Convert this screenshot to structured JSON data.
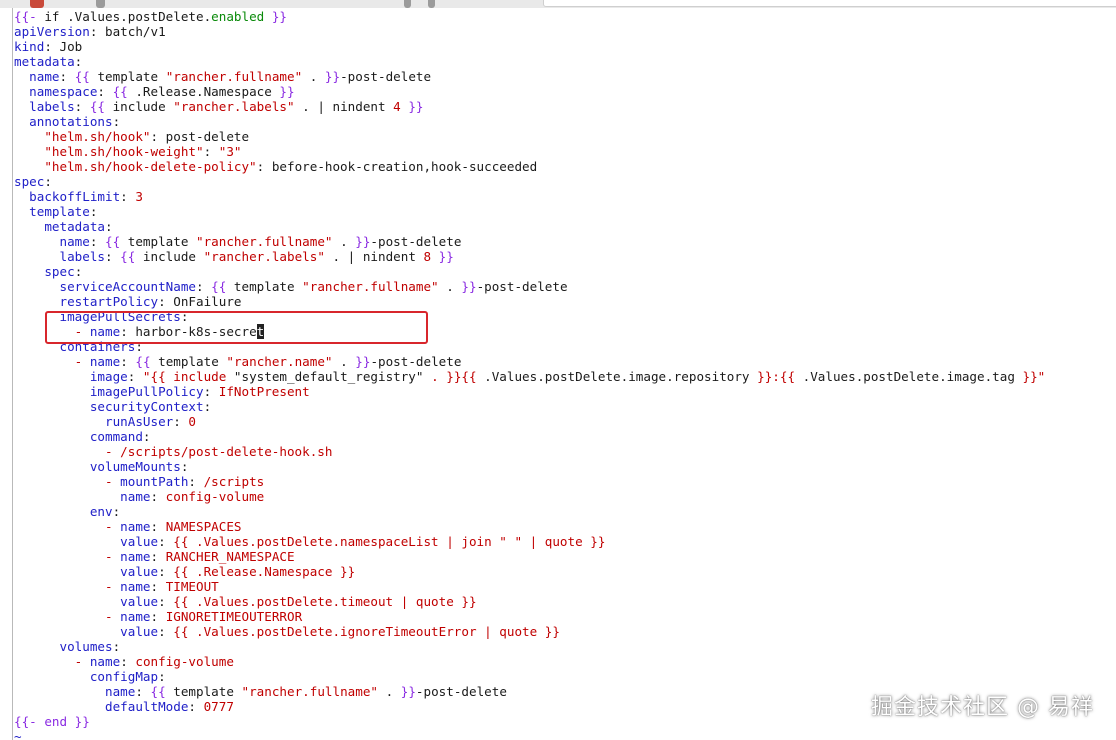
{
  "colors": {
    "template_delim": "#8a2be2",
    "yaml_key": "#2020c8",
    "string_value": "#c00000",
    "text": "#1a1a1a",
    "highlight_box": "#d8262c"
  },
  "editor": {
    "lines": [
      [
        [
          "kw",
          "{{- "
        ],
        [
          "plain",
          "if .Values.postDelete."
        ],
        [
          "green",
          "enabled"
        ],
        [
          "kw",
          " }}"
        ]
      ],
      [
        [
          "k1",
          "apiVersion"
        ],
        [
          "plain",
          ": batch/v1"
        ]
      ],
      [
        [
          "k1",
          "kind"
        ],
        [
          "plain",
          ": Job"
        ]
      ],
      [
        [
          "k1",
          "metadata"
        ],
        [
          "plain",
          ":"
        ]
      ],
      [
        [
          "plain",
          "  "
        ],
        [
          "k1",
          "name"
        ],
        [
          "plain",
          ": "
        ],
        [
          "kw",
          "{{"
        ],
        [
          "plain",
          " template "
        ],
        [
          "str",
          "\"rancher.fullname\""
        ],
        [
          "plain",
          " . "
        ],
        [
          "kw",
          "}}"
        ],
        [
          "plain",
          "-post-delete"
        ]
      ],
      [
        [
          "plain",
          "  "
        ],
        [
          "k1",
          "namespace"
        ],
        [
          "plain",
          ": "
        ],
        [
          "kw",
          "{{"
        ],
        [
          "plain",
          " .Release.Namespace "
        ],
        [
          "kw",
          "}}"
        ]
      ],
      [
        [
          "plain",
          "  "
        ],
        [
          "k1",
          "labels"
        ],
        [
          "plain",
          ": "
        ],
        [
          "kw",
          "{{"
        ],
        [
          "plain",
          " include "
        ],
        [
          "str",
          "\"rancher.labels\""
        ],
        [
          "plain",
          " . | nindent "
        ],
        [
          "num",
          "4"
        ],
        [
          "kw",
          " }}"
        ]
      ],
      [
        [
          "plain",
          "  "
        ],
        [
          "k1",
          "annotations"
        ],
        [
          "plain",
          ":"
        ]
      ],
      [
        [
          "plain",
          "    "
        ],
        [
          "str",
          "\"helm.sh/hook\""
        ],
        [
          "plain",
          ": post-delete"
        ]
      ],
      [
        [
          "plain",
          "    "
        ],
        [
          "str",
          "\"helm.sh/hook-weight\""
        ],
        [
          "plain",
          ": "
        ],
        [
          "str",
          "\"3\""
        ]
      ],
      [
        [
          "plain",
          "    "
        ],
        [
          "str",
          "\"helm.sh/hook-delete-policy\""
        ],
        [
          "plain",
          ": before-hook-creation,hook-succeeded"
        ]
      ],
      [
        [
          "k1",
          "spec"
        ],
        [
          "plain",
          ":"
        ]
      ],
      [
        [
          "plain",
          "  "
        ],
        [
          "k1",
          "backoffLimit"
        ],
        [
          "plain",
          ": "
        ],
        [
          "num",
          "3"
        ]
      ],
      [
        [
          "plain",
          "  "
        ],
        [
          "k1",
          "template"
        ],
        [
          "plain",
          ":"
        ]
      ],
      [
        [
          "plain",
          "    "
        ],
        [
          "k1",
          "metadata"
        ],
        [
          "plain",
          ":"
        ]
      ],
      [
        [
          "plain",
          "      "
        ],
        [
          "k1",
          "name"
        ],
        [
          "plain",
          ": "
        ],
        [
          "kw",
          "{{"
        ],
        [
          "plain",
          " template "
        ],
        [
          "str",
          "\"rancher.fullname\""
        ],
        [
          "plain",
          " . "
        ],
        [
          "kw",
          "}}"
        ],
        [
          "plain",
          "-post-delete"
        ]
      ],
      [
        [
          "plain",
          "      "
        ],
        [
          "k1",
          "labels"
        ],
        [
          "plain",
          ": "
        ],
        [
          "kw",
          "{{"
        ],
        [
          "plain",
          " include "
        ],
        [
          "str",
          "\"rancher.labels\""
        ],
        [
          "plain",
          " . | nindent "
        ],
        [
          "num",
          "8"
        ],
        [
          "kw",
          " }}"
        ]
      ],
      [
        [
          "plain",
          "    "
        ],
        [
          "k1",
          "spec"
        ],
        [
          "plain",
          ":"
        ]
      ],
      [
        [
          "plain",
          "      "
        ],
        [
          "k1",
          "serviceAccountName"
        ],
        [
          "plain",
          ": "
        ],
        [
          "kw",
          "{{"
        ],
        [
          "plain",
          " template "
        ],
        [
          "str",
          "\"rancher.fullname\""
        ],
        [
          "plain",
          " . "
        ],
        [
          "kw",
          "}}"
        ],
        [
          "plain",
          "-post-delete"
        ]
      ],
      [
        [
          "plain",
          "      "
        ],
        [
          "k1",
          "restartPolicy"
        ],
        [
          "plain",
          ": OnFailure"
        ]
      ],
      [
        [
          "plain",
          "      "
        ],
        [
          "k1",
          "imagePullSecrets"
        ],
        [
          "plain",
          ":"
        ]
      ],
      [
        [
          "plain",
          "        "
        ],
        [
          "str",
          "- "
        ],
        [
          "k1",
          "name"
        ],
        [
          "plain",
          ": harbor-k8s-secre"
        ],
        [
          "cursor",
          "t"
        ]
      ],
      [
        [
          "plain",
          "      "
        ],
        [
          "k1",
          "containers"
        ],
        [
          "plain",
          ":"
        ]
      ],
      [
        [
          "plain",
          "        "
        ],
        [
          "str",
          "- "
        ],
        [
          "k1",
          "name"
        ],
        [
          "plain",
          ": "
        ],
        [
          "kw",
          "{{"
        ],
        [
          "plain",
          " template "
        ],
        [
          "str",
          "\"rancher.name\""
        ],
        [
          "plain",
          " . "
        ],
        [
          "kw",
          "}}"
        ],
        [
          "plain",
          "-post-delete"
        ]
      ],
      [
        [
          "plain",
          "          "
        ],
        [
          "k1",
          "image"
        ],
        [
          "plain",
          ": "
        ],
        [
          "str",
          "\"{{ include "
        ],
        [
          "plain",
          "\"system_default_registry\""
        ],
        [
          "str",
          " . }}{{"
        ],
        [
          "plain",
          " .Values.postDelete.image.repository "
        ],
        [
          "str",
          "}}:{{"
        ],
        [
          "plain",
          " .Values.postDelete.image.tag "
        ],
        [
          "str",
          "}}\""
        ]
      ],
      [
        [
          "plain",
          "          "
        ],
        [
          "k1",
          "imagePullPolicy"
        ],
        [
          "plain",
          ": "
        ],
        [
          "str",
          "IfNotPresent"
        ]
      ],
      [
        [
          "plain",
          "          "
        ],
        [
          "k1",
          "securityContext"
        ],
        [
          "plain",
          ":"
        ]
      ],
      [
        [
          "plain",
          "            "
        ],
        [
          "k1",
          "runAsUser"
        ],
        [
          "plain",
          ": "
        ],
        [
          "num",
          "0"
        ]
      ],
      [
        [
          "plain",
          "          "
        ],
        [
          "k1",
          "command"
        ],
        [
          "plain",
          ":"
        ]
      ],
      [
        [
          "plain",
          "            "
        ],
        [
          "str",
          "- /scripts/post-delete-hook.sh"
        ]
      ],
      [
        [
          "plain",
          "          "
        ],
        [
          "k1",
          "volumeMounts"
        ],
        [
          "plain",
          ":"
        ]
      ],
      [
        [
          "plain",
          "            "
        ],
        [
          "str",
          "- "
        ],
        [
          "k1",
          "mountPath"
        ],
        [
          "plain",
          ": "
        ],
        [
          "str",
          "/scripts"
        ]
      ],
      [
        [
          "plain",
          "              "
        ],
        [
          "k1",
          "name"
        ],
        [
          "plain",
          ": "
        ],
        [
          "str",
          "config-volume"
        ]
      ],
      [
        [
          "plain",
          "          "
        ],
        [
          "k1",
          "env"
        ],
        [
          "plain",
          ":"
        ]
      ],
      [
        [
          "plain",
          "            "
        ],
        [
          "str",
          "- "
        ],
        [
          "k1",
          "name"
        ],
        [
          "plain",
          ": "
        ],
        [
          "str",
          "NAMESPACES"
        ]
      ],
      [
        [
          "plain",
          "              "
        ],
        [
          "k1",
          "value"
        ],
        [
          "plain",
          ": "
        ],
        [
          "str",
          "{{ .Values.postDelete.namespaceList | join \" \" | quote }}"
        ]
      ],
      [
        [
          "plain",
          "            "
        ],
        [
          "str",
          "- "
        ],
        [
          "k1",
          "name"
        ],
        [
          "plain",
          ": "
        ],
        [
          "str",
          "RANCHER_NAMESPACE"
        ]
      ],
      [
        [
          "plain",
          "              "
        ],
        [
          "k1",
          "value"
        ],
        [
          "plain",
          ": "
        ],
        [
          "str",
          "{{ .Release.Namespace }}"
        ]
      ],
      [
        [
          "plain",
          "            "
        ],
        [
          "str",
          "- "
        ],
        [
          "k1",
          "name"
        ],
        [
          "plain",
          ": "
        ],
        [
          "str",
          "TIMEOUT"
        ]
      ],
      [
        [
          "plain",
          "              "
        ],
        [
          "k1",
          "value"
        ],
        [
          "plain",
          ": "
        ],
        [
          "str",
          "{{ .Values.postDelete.timeout | quote }}"
        ]
      ],
      [
        [
          "plain",
          "            "
        ],
        [
          "str",
          "- "
        ],
        [
          "k1",
          "name"
        ],
        [
          "plain",
          ": "
        ],
        [
          "str",
          "IGNORETIMEOUTERROR"
        ]
      ],
      [
        [
          "plain",
          "              "
        ],
        [
          "k1",
          "value"
        ],
        [
          "plain",
          ": "
        ],
        [
          "str",
          "{{ .Values.postDelete.ignoreTimeoutError | quote }}"
        ]
      ],
      [
        [
          "plain",
          "      "
        ],
        [
          "k1",
          "volumes"
        ],
        [
          "plain",
          ":"
        ]
      ],
      [
        [
          "plain",
          "        "
        ],
        [
          "str",
          "- "
        ],
        [
          "k1",
          "name"
        ],
        [
          "plain",
          ": "
        ],
        [
          "str",
          "config-volume"
        ]
      ],
      [
        [
          "plain",
          "          "
        ],
        [
          "k1",
          "configMap"
        ],
        [
          "plain",
          ":"
        ]
      ],
      [
        [
          "plain",
          "            "
        ],
        [
          "k1",
          "name"
        ],
        [
          "plain",
          ": "
        ],
        [
          "kw",
          "{{"
        ],
        [
          "plain",
          " template "
        ],
        [
          "str",
          "\"rancher.fullname\""
        ],
        [
          "plain",
          " . "
        ],
        [
          "kw",
          "}}"
        ],
        [
          "plain",
          "-post-delete"
        ]
      ],
      [
        [
          "plain",
          "            "
        ],
        [
          "k1",
          "defaultMode"
        ],
        [
          "plain",
          ": "
        ],
        [
          "num",
          "0777"
        ]
      ],
      [
        [
          "kw",
          "{{- end }}"
        ]
      ]
    ],
    "tilde": "~"
  },
  "watermark": "掘金技术社区 @ 易祥"
}
